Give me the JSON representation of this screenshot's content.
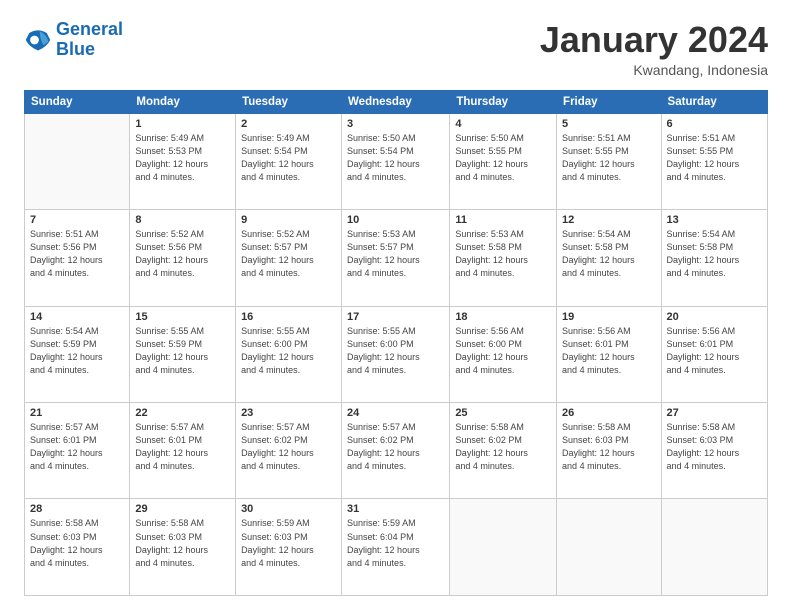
{
  "logo": {
    "line1": "General",
    "line2": "Blue"
  },
  "header": {
    "title": "January 2024",
    "subtitle": "Kwandang, Indonesia"
  },
  "days_of_week": [
    "Sunday",
    "Monday",
    "Tuesday",
    "Wednesday",
    "Thursday",
    "Friday",
    "Saturday"
  ],
  "weeks": [
    [
      {
        "day": "",
        "sunrise": "",
        "sunset": "",
        "daylight": "",
        "empty": true
      },
      {
        "day": "1",
        "sunrise": "Sunrise: 5:49 AM",
        "sunset": "Sunset: 5:53 PM",
        "daylight": "Daylight: 12 hours and 4 minutes."
      },
      {
        "day": "2",
        "sunrise": "Sunrise: 5:49 AM",
        "sunset": "Sunset: 5:54 PM",
        "daylight": "Daylight: 12 hours and 4 minutes."
      },
      {
        "day": "3",
        "sunrise": "Sunrise: 5:50 AM",
        "sunset": "Sunset: 5:54 PM",
        "daylight": "Daylight: 12 hours and 4 minutes."
      },
      {
        "day": "4",
        "sunrise": "Sunrise: 5:50 AM",
        "sunset": "Sunset: 5:55 PM",
        "daylight": "Daylight: 12 hours and 4 minutes."
      },
      {
        "day": "5",
        "sunrise": "Sunrise: 5:51 AM",
        "sunset": "Sunset: 5:55 PM",
        "daylight": "Daylight: 12 hours and 4 minutes."
      },
      {
        "day": "6",
        "sunrise": "Sunrise: 5:51 AM",
        "sunset": "Sunset: 5:55 PM",
        "daylight": "Daylight: 12 hours and 4 minutes."
      }
    ],
    [
      {
        "day": "7",
        "sunrise": "Sunrise: 5:51 AM",
        "sunset": "Sunset: 5:56 PM",
        "daylight": "Daylight: 12 hours and 4 minutes."
      },
      {
        "day": "8",
        "sunrise": "Sunrise: 5:52 AM",
        "sunset": "Sunset: 5:56 PM",
        "daylight": "Daylight: 12 hours and 4 minutes."
      },
      {
        "day": "9",
        "sunrise": "Sunrise: 5:52 AM",
        "sunset": "Sunset: 5:57 PM",
        "daylight": "Daylight: 12 hours and 4 minutes."
      },
      {
        "day": "10",
        "sunrise": "Sunrise: 5:53 AM",
        "sunset": "Sunset: 5:57 PM",
        "daylight": "Daylight: 12 hours and 4 minutes."
      },
      {
        "day": "11",
        "sunrise": "Sunrise: 5:53 AM",
        "sunset": "Sunset: 5:58 PM",
        "daylight": "Daylight: 12 hours and 4 minutes."
      },
      {
        "day": "12",
        "sunrise": "Sunrise: 5:54 AM",
        "sunset": "Sunset: 5:58 PM",
        "daylight": "Daylight: 12 hours and 4 minutes."
      },
      {
        "day": "13",
        "sunrise": "Sunrise: 5:54 AM",
        "sunset": "Sunset: 5:58 PM",
        "daylight": "Daylight: 12 hours and 4 minutes."
      }
    ],
    [
      {
        "day": "14",
        "sunrise": "Sunrise: 5:54 AM",
        "sunset": "Sunset: 5:59 PM",
        "daylight": "Daylight: 12 hours and 4 minutes."
      },
      {
        "day": "15",
        "sunrise": "Sunrise: 5:55 AM",
        "sunset": "Sunset: 5:59 PM",
        "daylight": "Daylight: 12 hours and 4 minutes."
      },
      {
        "day": "16",
        "sunrise": "Sunrise: 5:55 AM",
        "sunset": "Sunset: 6:00 PM",
        "daylight": "Daylight: 12 hours and 4 minutes."
      },
      {
        "day": "17",
        "sunrise": "Sunrise: 5:55 AM",
        "sunset": "Sunset: 6:00 PM",
        "daylight": "Daylight: 12 hours and 4 minutes."
      },
      {
        "day": "18",
        "sunrise": "Sunrise: 5:56 AM",
        "sunset": "Sunset: 6:00 PM",
        "daylight": "Daylight: 12 hours and 4 minutes."
      },
      {
        "day": "19",
        "sunrise": "Sunrise: 5:56 AM",
        "sunset": "Sunset: 6:01 PM",
        "daylight": "Daylight: 12 hours and 4 minutes."
      },
      {
        "day": "20",
        "sunrise": "Sunrise: 5:56 AM",
        "sunset": "Sunset: 6:01 PM",
        "daylight": "Daylight: 12 hours and 4 minutes."
      }
    ],
    [
      {
        "day": "21",
        "sunrise": "Sunrise: 5:57 AM",
        "sunset": "Sunset: 6:01 PM",
        "daylight": "Daylight: 12 hours and 4 minutes."
      },
      {
        "day": "22",
        "sunrise": "Sunrise: 5:57 AM",
        "sunset": "Sunset: 6:01 PM",
        "daylight": "Daylight: 12 hours and 4 minutes."
      },
      {
        "day": "23",
        "sunrise": "Sunrise: 5:57 AM",
        "sunset": "Sunset: 6:02 PM",
        "daylight": "Daylight: 12 hours and 4 minutes."
      },
      {
        "day": "24",
        "sunrise": "Sunrise: 5:57 AM",
        "sunset": "Sunset: 6:02 PM",
        "daylight": "Daylight: 12 hours and 4 minutes."
      },
      {
        "day": "25",
        "sunrise": "Sunrise: 5:58 AM",
        "sunset": "Sunset: 6:02 PM",
        "daylight": "Daylight: 12 hours and 4 minutes."
      },
      {
        "day": "26",
        "sunrise": "Sunrise: 5:58 AM",
        "sunset": "Sunset: 6:03 PM",
        "daylight": "Daylight: 12 hours and 4 minutes."
      },
      {
        "day": "27",
        "sunrise": "Sunrise: 5:58 AM",
        "sunset": "Sunset: 6:03 PM",
        "daylight": "Daylight: 12 hours and 4 minutes."
      }
    ],
    [
      {
        "day": "28",
        "sunrise": "Sunrise: 5:58 AM",
        "sunset": "Sunset: 6:03 PM",
        "daylight": "Daylight: 12 hours and 4 minutes."
      },
      {
        "day": "29",
        "sunrise": "Sunrise: 5:58 AM",
        "sunset": "Sunset: 6:03 PM",
        "daylight": "Daylight: 12 hours and 4 minutes."
      },
      {
        "day": "30",
        "sunrise": "Sunrise: 5:59 AM",
        "sunset": "Sunset: 6:03 PM",
        "daylight": "Daylight: 12 hours and 4 minutes."
      },
      {
        "day": "31",
        "sunrise": "Sunrise: 5:59 AM",
        "sunset": "Sunset: 6:04 PM",
        "daylight": "Daylight: 12 hours and 4 minutes."
      },
      {
        "day": "",
        "sunrise": "",
        "sunset": "",
        "daylight": "",
        "empty": true
      },
      {
        "day": "",
        "sunrise": "",
        "sunset": "",
        "daylight": "",
        "empty": true
      },
      {
        "day": "",
        "sunrise": "",
        "sunset": "",
        "daylight": "",
        "empty": true
      }
    ]
  ]
}
